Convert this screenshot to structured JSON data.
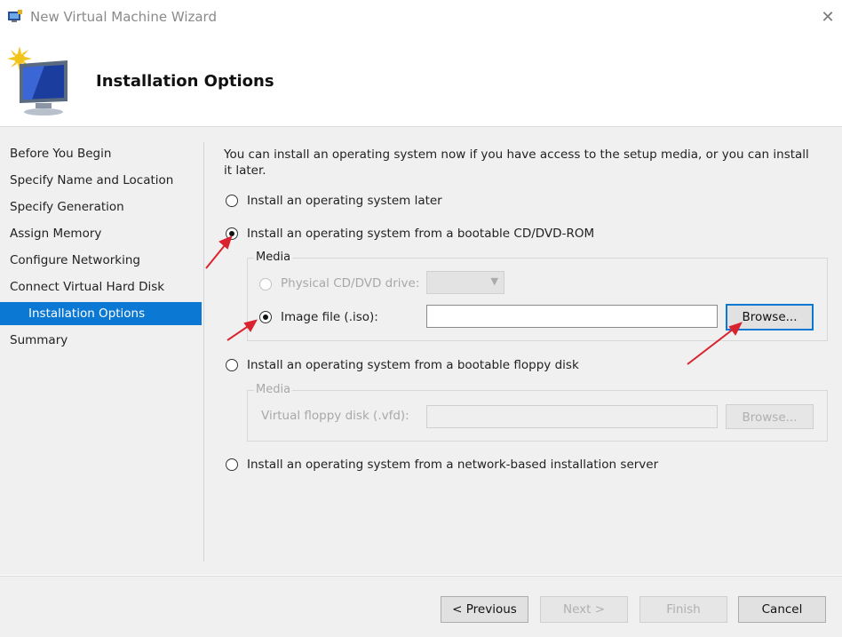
{
  "window": {
    "title": "New Virtual Machine Wizard",
    "app_icon": "virtual-machine-icon",
    "close_glyph": "✕"
  },
  "header": {
    "title": "Installation Options",
    "icon": "monitor-wizard-icon"
  },
  "nav": {
    "items": [
      {
        "label": "Before You Begin"
      },
      {
        "label": "Specify Name and Location"
      },
      {
        "label": "Specify Generation"
      },
      {
        "label": "Assign Memory"
      },
      {
        "label": "Configure Networking"
      },
      {
        "label": "Connect Virtual Hard Disk"
      },
      {
        "label": "Installation Options",
        "active": true
      },
      {
        "label": "Summary"
      }
    ]
  },
  "content": {
    "intro": "You can install an operating system now if you have access to the setup media, or you can install it later.",
    "option_later": "Install an operating system later",
    "option_cd": "Install an operating system from a bootable CD/DVD-ROM",
    "cd_media": {
      "group_label": "Media",
      "physical_label": "Physical CD/DVD drive:",
      "physical_value": "",
      "image_label": "Image file (.iso):",
      "image_value": "",
      "browse_label": "Browse..."
    },
    "option_floppy": "Install an operating system from a bootable floppy disk",
    "floppy_media": {
      "group_label": "Media",
      "floppy_label": "Virtual floppy disk (.vfd):",
      "floppy_value": "",
      "browse_label": "Browse..."
    },
    "option_network": "Install an operating system from a network-based installation server",
    "selected_option": "cd"
  },
  "footer": {
    "previous_label": "< Previous",
    "next_label": "Next >",
    "finish_label": "Finish",
    "cancel_label": "Cancel"
  },
  "colors": {
    "accent": "#0b78d4",
    "annotation_arrow": "#d9232e"
  }
}
